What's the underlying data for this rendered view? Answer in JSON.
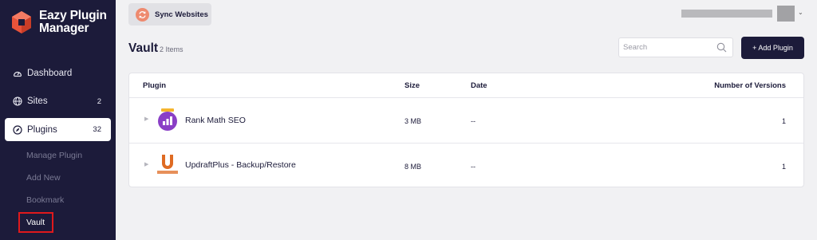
{
  "app": {
    "logo_line1": "Eazy Plugin",
    "logo_line2": "Manager",
    "brand_color": "#1c1b3a",
    "accent_color": "#e8533a"
  },
  "sidebar": {
    "items": [
      {
        "label": "Dashboard",
        "icon": "gauge-icon",
        "count": ""
      },
      {
        "label": "Sites",
        "icon": "globe-icon",
        "count": "2"
      },
      {
        "label": "Plugins",
        "icon": "plug-icon",
        "count": "32",
        "active": true
      }
    ],
    "sub_items": [
      {
        "label": "Manage Plugin"
      },
      {
        "label": "Add New"
      },
      {
        "label": "Bookmark"
      },
      {
        "label": "Vault",
        "active": true
      }
    ]
  },
  "topbar": {
    "sync_label": "Sync Websites"
  },
  "page": {
    "title": "Vault",
    "count_text": "2 Items",
    "search_placeholder": "Search",
    "add_button": "+ Add Plugin"
  },
  "table": {
    "headers": {
      "plugin": "Plugin",
      "size": "Size",
      "date": "Date",
      "versions": "Number of Versions"
    },
    "rows": [
      {
        "name": "Rank Math SEO",
        "icon": "rank-math-icon",
        "size": "3 MB",
        "date": "--",
        "versions": "1"
      },
      {
        "name": "UpdraftPlus - Backup/Restore",
        "icon": "updraftplus-icon",
        "size": "8 MB",
        "date": "--",
        "versions": "1"
      }
    ]
  }
}
